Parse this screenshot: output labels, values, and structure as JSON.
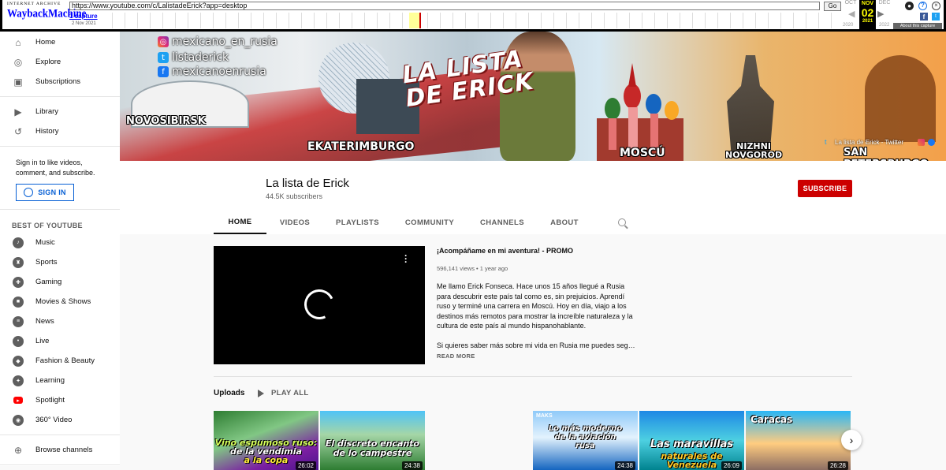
{
  "wayback": {
    "logo_top": "INTERNET ARCHIVE",
    "logo_main": "WaybackMachine",
    "url": "https://www.youtube.com/c/LalistadeErick?app=desktop",
    "go_label": "Go",
    "captures_label": "1 capture",
    "capture_date": "2 Nov 2021",
    "prev_month": "OCT",
    "current_month": "NOV",
    "current_day": "02",
    "current_year": "2021",
    "next_month": "DEC",
    "prev_year": "2020",
    "next_year": "2022",
    "about_label": "About this capture",
    "facebook_glyph": "f",
    "twitter_glyph": "t"
  },
  "sidebar": {
    "main_items": [
      {
        "label": "Home",
        "icon": "home-icon"
      },
      {
        "label": "Explore",
        "icon": "compass-icon"
      },
      {
        "label": "Subscriptions",
        "icon": "subscriptions-icon"
      }
    ],
    "library_items": [
      {
        "label": "Library",
        "icon": "library-icon"
      },
      {
        "label": "History",
        "icon": "history-icon"
      }
    ],
    "signin_text": "Sign in to like videos, comment, and subscribe.",
    "signin_button": "SIGN IN",
    "best_heading": "BEST OF YOUTUBE",
    "best_items": [
      {
        "label": "Music",
        "icon": "music-icon"
      },
      {
        "label": "Sports",
        "icon": "trophy-icon"
      },
      {
        "label": "Gaming",
        "icon": "gaming-icon"
      },
      {
        "label": "Movies & Shows",
        "icon": "movies-icon"
      },
      {
        "label": "News",
        "icon": "news-icon"
      },
      {
        "label": "Live",
        "icon": "live-icon"
      },
      {
        "label": "Fashion & Beauty",
        "icon": "fashion-icon"
      },
      {
        "label": "Learning",
        "icon": "learning-icon"
      },
      {
        "label": "Spotlight",
        "icon": "spotlight-icon"
      },
      {
        "label": "360° Video",
        "icon": "360-video-icon"
      }
    ],
    "browse_channels": "Browse channels"
  },
  "banner": {
    "instagram": "mexicano_en_rusia",
    "twitter": "listaderick",
    "facebook": "mexicanoenrusia",
    "title_line1": "LA LISTA",
    "title_line2": "DE ERICK",
    "city_1": "NOVOSIBIRSK",
    "city_2": "EKATERIMBURGO",
    "city_3": "MOSCÚ",
    "city_4_line1": "NIZHNI",
    "city_4_line2": "NOVGOROD",
    "city_5": "SAN PETERSBURGO",
    "link_label": "La lista de Erick - Twitter"
  },
  "channel": {
    "name": "La lista de Erick",
    "subscribers": "44.5K subscribers",
    "subscribe_label": "SUBSCRIBE",
    "tabs": [
      "HOME",
      "VIDEOS",
      "PLAYLISTS",
      "COMMUNITY",
      "CHANNELS",
      "ABOUT"
    ]
  },
  "promo": {
    "title": "¡Acompáñame en mi aventura! - PROMO",
    "meta": "596,141 views • 1 year ago",
    "description_1": "Me llamo Erick Fonseca. Hace unos 15 años llegué a Rusia para descubrir este país tal como es, sin prejuicios. Aprendí ruso y terminé una carrera en Moscú. Hoy en día, viajo a los destinos más remotos para mostrar la increíble naturaleza y la cultura de este país al mundo hispanohablante.",
    "description_2": "Si quieres saber más sobre mi vida en Rusia me puedes seguir en las redes sociales",
    "read_more": "READ MORE"
  },
  "uploads": {
    "label": "Uploads",
    "play_all": "PLAY ALL",
    "videos": [
      {
        "caption_1": "Vino espumoso ruso:",
        "caption_2": "de la vendimia",
        "caption_3": "a la copa",
        "duration": "26:02"
      },
      {
        "caption_1": "El discreto encanto",
        "caption_2": "de lo campestre",
        "duration": "24:38"
      },
      {
        "brand": "MAKS",
        "caption_1": "Lo más moderno",
        "caption_2": "de la aviación",
        "caption_3": "rusa",
        "duration": "24:38"
      },
      {
        "caption_1": "Las maravillas",
        "caption_2": "naturales de Venezuela",
        "duration": "26:09"
      },
      {
        "caption_1": "Caracas",
        "duration": "26:28"
      }
    ]
  }
}
